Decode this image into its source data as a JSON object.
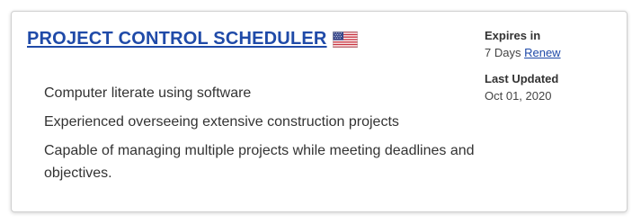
{
  "job": {
    "title": "PROJECT CONTROL SCHEDULER",
    "flag_icon": "us-flag-icon",
    "bullets": [
      "Computer literate using software",
      "Experienced overseeing extensive construction projects",
      "Capable of managing multiple projects while meeting deadlines and objectives."
    ]
  },
  "meta": {
    "expires_label": "Expires in",
    "expires_value": "7 Days",
    "renew_label": "Renew",
    "updated_label": "Last Updated",
    "updated_value": "Oct 01, 2020"
  },
  "colors": {
    "link": "#1f4aa8",
    "text": "#333333",
    "border": "#d0d0d0"
  }
}
